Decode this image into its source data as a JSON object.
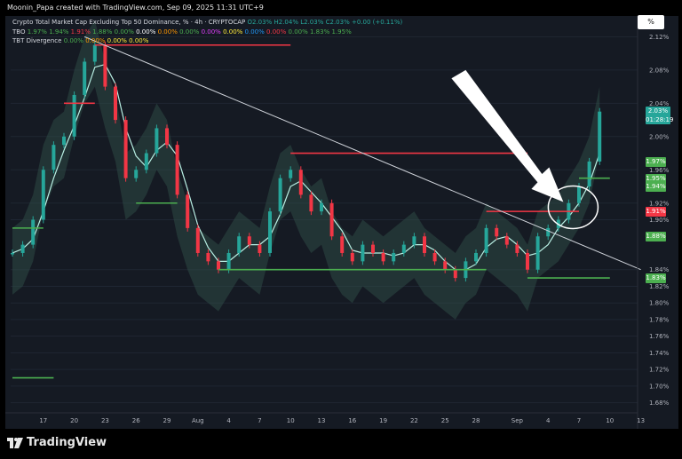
{
  "header": {
    "credit": "Moonin_Papa created with TradingView.com, Sep 09, 2025 11:31 UTC+9",
    "symbol": "Crypto Total Market Cap Excluding Top 50 Dominance, % · 4h · CRYPTOCAP",
    "ohlc": {
      "open_label": "O",
      "open": "2.03%",
      "high_label": "H",
      "high": "2.04%",
      "low_label": "L",
      "low": "2.03%",
      "close_label": "C",
      "close": "2.03%",
      "change": "+0.00 (+0.11%)"
    },
    "tbo": {
      "name": "TBO",
      "values": [
        "1.97%",
        "1.94%",
        "1.91%",
        "1.88%",
        "0.00%",
        "0.00%",
        "0.00%",
        "0.00%",
        "0.00%",
        "0.00%",
        "0.00%",
        "0.00%",
        "0.00%",
        "1.83%",
        "1.95%"
      ]
    },
    "tbt": {
      "name": "TBT Divergence",
      "values": [
        "0.00%",
        "0.00%",
        "0.00%",
        "0.00%"
      ]
    },
    "percent_button": "%"
  },
  "price_axis": {
    "ticks": [
      "2.12%",
      "2.08%",
      "2.04%",
      "2.00%",
      "1.96%",
      "1.92%",
      "1.90%",
      "1.84%",
      "1.82%",
      "1.80%",
      "1.78%",
      "1.76%",
      "1.74%",
      "1.72%",
      "1.70%",
      "1.68%"
    ],
    "current_price": "2.03%",
    "countdown": "01:28:19",
    "level_tags": [
      {
        "label": "1.97%",
        "value": 1.97,
        "color": "#4caf50"
      },
      {
        "label": "1.95%",
        "value": 1.95,
        "color": "#4caf50"
      },
      {
        "label": "1.94%",
        "value": 1.94,
        "color": "#4caf50"
      },
      {
        "label": "1.91%",
        "value": 1.91,
        "color": "#f23645"
      },
      {
        "label": "1.88%",
        "value": 1.88,
        "color": "#4caf50"
      },
      {
        "label": "1.83%",
        "value": 1.83,
        "color": "#4caf50"
      }
    ]
  },
  "time_axis": {
    "ticks": [
      "17",
      "20",
      "23",
      "26",
      "29",
      "Aug",
      "4",
      "7",
      "10",
      "13",
      "16",
      "19",
      "22",
      "25",
      "28",
      "Sep",
      "4",
      "7",
      "10",
      "13"
    ]
  },
  "branding": {
    "logo_text": "TradingView"
  },
  "colors": {
    "background": "#151a23",
    "up": "#26a69a",
    "down": "#f23645",
    "support_line": "#4caf50",
    "resistance_line": "#f23645",
    "trendline": "#cfd3da",
    "annotation": "#ffffff"
  },
  "chart_data": {
    "type": "candlestick",
    "title": "Crypto Total Market Cap Excluding Top 50 Dominance, %",
    "interval": "4h",
    "y_unit": "%",
    "ylim": [
      1.67,
      2.13
    ],
    "x_range": [
      "Jul 14, 2025",
      "Sep 14, 2025"
    ],
    "price_path": [
      {
        "date": "Jul 14",
        "value": 1.86
      },
      {
        "date": "Jul 15",
        "value": 1.87
      },
      {
        "date": "Jul 16",
        "value": 1.9
      },
      {
        "date": "Jul 17",
        "value": 1.96
      },
      {
        "date": "Jul 18",
        "value": 1.99
      },
      {
        "date": "Jul 19",
        "value": 2.0
      },
      {
        "date": "Jul 20",
        "value": 2.05
      },
      {
        "date": "Jul 21",
        "value": 2.09
      },
      {
        "date": "Jul 22",
        "value": 2.11
      },
      {
        "date": "Jul 23",
        "value": 2.06
      },
      {
        "date": "Jul 24",
        "value": 2.02
      },
      {
        "date": "Jul 25",
        "value": 1.95
      },
      {
        "date": "Jul 26",
        "value": 1.96
      },
      {
        "date": "Jul 27",
        "value": 1.98
      },
      {
        "date": "Jul 28",
        "value": 2.01
      },
      {
        "date": "Jul 29",
        "value": 1.99
      },
      {
        "date": "Jul 30",
        "value": 1.93
      },
      {
        "date": "Jul 31",
        "value": 1.89
      },
      {
        "date": "Aug 1",
        "value": 1.86
      },
      {
        "date": "Aug 2",
        "value": 1.85
      },
      {
        "date": "Aug 3",
        "value": 1.84
      },
      {
        "date": "Aug 4",
        "value": 1.86
      },
      {
        "date": "Aug 5",
        "value": 1.88
      },
      {
        "date": "Aug 6",
        "value": 1.87
      },
      {
        "date": "Aug 7",
        "value": 1.86
      },
      {
        "date": "Aug 8",
        "value": 1.91
      },
      {
        "date": "Aug 9",
        "value": 1.95
      },
      {
        "date": "Aug 10",
        "value": 1.96
      },
      {
        "date": "Aug 11",
        "value": 1.93
      },
      {
        "date": "Aug 12",
        "value": 1.91
      },
      {
        "date": "Aug 13",
        "value": 1.92
      },
      {
        "date": "Aug 14",
        "value": 1.88
      },
      {
        "date": "Aug 15",
        "value": 1.86
      },
      {
        "date": "Aug 16",
        "value": 1.85
      },
      {
        "date": "Aug 17",
        "value": 1.87
      },
      {
        "date": "Aug 18",
        "value": 1.86
      },
      {
        "date": "Aug 19",
        "value": 1.85
      },
      {
        "date": "Aug 20",
        "value": 1.86
      },
      {
        "date": "Aug 21",
        "value": 1.87
      },
      {
        "date": "Aug 22",
        "value": 1.88
      },
      {
        "date": "Aug 23",
        "value": 1.86
      },
      {
        "date": "Aug 24",
        "value": 1.85
      },
      {
        "date": "Aug 25",
        "value": 1.84
      },
      {
        "date": "Aug 26",
        "value": 1.83
      },
      {
        "date": "Aug 27",
        "value": 1.85
      },
      {
        "date": "Aug 28",
        "value": 1.86
      },
      {
        "date": "Aug 29",
        "value": 1.89
      },
      {
        "date": "Aug 30",
        "value": 1.88
      },
      {
        "date": "Aug 31",
        "value": 1.87
      },
      {
        "date": "Sep 1",
        "value": 1.86
      },
      {
        "date": "Sep 2",
        "value": 1.84
      },
      {
        "date": "Sep 3",
        "value": 1.88
      },
      {
        "date": "Sep 4",
        "value": 1.89
      },
      {
        "date": "Sep 5",
        "value": 1.9
      },
      {
        "date": "Sep 6",
        "value": 1.92
      },
      {
        "date": "Sep 7",
        "value": 1.94
      },
      {
        "date": "Sep 8",
        "value": 1.97
      },
      {
        "date": "Sep 9",
        "value": 2.03
      }
    ],
    "levels": [
      {
        "kind": "resistance",
        "value": 2.11,
        "from": "Jul 22",
        "to": "Aug 10"
      },
      {
        "kind": "resistance",
        "value": 2.04,
        "from": "Jul 19",
        "to": "Jul 22"
      },
      {
        "kind": "resistance",
        "value": 1.98,
        "from": "Aug 10",
        "to": "Sep 2"
      },
      {
        "kind": "resistance",
        "value": 1.91,
        "from": "Aug 29",
        "to": "Sep 7"
      },
      {
        "kind": "support",
        "value": 1.89,
        "from": "Jul 14",
        "to": "Jul 17"
      },
      {
        "kind": "support",
        "value": 1.92,
        "from": "Jul 26",
        "to": "Jul 30"
      },
      {
        "kind": "support",
        "value": 1.84,
        "from": "Aug 3",
        "to": "Aug 29"
      },
      {
        "kind": "support",
        "value": 1.83,
        "from": "Sep 2",
        "to": "Sep 10"
      },
      {
        "kind": "support",
        "value": 1.95,
        "from": "Sep 7",
        "to": "Sep 10"
      },
      {
        "kind": "support",
        "value": 1.71,
        "from": "Jul 14",
        "to": "Jul 18"
      }
    ],
    "trendline": {
      "from": {
        "date": "Jul 21",
        "value": 2.12
      },
      "to": {
        "date": "Sep 13",
        "value": 1.84
      }
    }
  }
}
